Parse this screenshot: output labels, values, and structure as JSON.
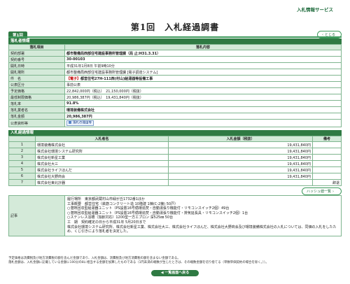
{
  "header": {
    "service_title": "入札情報サービス",
    "page_title": "第1回　入札経過調書"
  },
  "tab_label": "第1回",
  "close_label": "とじる",
  "result_section": {
    "title": "落札者情報",
    "col_item": "落札項目",
    "col_content": "落札内容",
    "rows": [
      {
        "label": "契約部署",
        "value": "都市整備局西部住宅建設事務所管理課（局 止:H31.3.31）",
        "bold": true
      },
      {
        "label": "契約番号",
        "value": "30-00103",
        "bold": true
      },
      {
        "label": "開札日時",
        "value": "平成31年1月8日 午前9時10分"
      },
      {
        "label": "開札場所",
        "value": "都市整備局西部住宅建設事務所管理課 [電子調達システム]"
      },
      {
        "label": "件　名",
        "prefix": "【電子】",
        "value": "都営住宅27H-111西(村山)給湯器等設備工事"
      },
      {
        "label": "公表区分",
        "value": "事前公表"
      },
      {
        "label": "予定価格",
        "value": "22,842,000円（税込）　21,150,000円（税抜）"
      },
      {
        "label": "最低制限価格",
        "value": "20,986,387円（税込）　19,431,840円（税抜）"
      },
      {
        "label": "落札率",
        "value": "91.8%",
        "bold": true
      },
      {
        "label": "落札業者名",
        "value": "環境装備株式会社",
        "bold": true
      },
      {
        "label": "落札金額",
        "value": "20,986,387円",
        "bold": true
      },
      {
        "label": "公表資料等",
        "button": "落札の理由等"
      }
    ]
  },
  "bids_section": {
    "title": "入札経過情報",
    "col_no": "",
    "col_name": "入札者名",
    "col_amount": "入札金額（税抜）",
    "col_note": "備考",
    "rows": [
      {
        "no": "1",
        "name": "環境装備株式会社",
        "amount": "19,431,840円",
        "note": ""
      },
      {
        "no": "2",
        "name": "株式会社環境システム研究所",
        "amount": "19,431,840円",
        "note": ""
      },
      {
        "no": "3",
        "name": "株式会社新星工業",
        "amount": "19,431,840円",
        "note": ""
      },
      {
        "no": "4",
        "name": "株式会社大三",
        "amount": "19,431,840円",
        "note": ""
      },
      {
        "no": "5",
        "name": "株式会社ライフほんだ",
        "amount": "19,431,840円",
        "note": ""
      },
      {
        "no": "6",
        "name": "株式会社大野商会",
        "amount": "19,431,840円",
        "note": ""
      },
      {
        "no": "7",
        "name": "株式会社東北計器",
        "amount": "",
        "note": "辞退"
      }
    ]
  },
  "history_button": "ハッシュ値一覧",
  "remarks": {
    "label": "記事",
    "lines": [
      "履行場所　東京都武蔵村山市緑が丘1732番1ほか",
      "工事概要　都営住宅（鉄筋コンクリート造 10階建 1棟(C-2棟) 50戸）",
      "○潜熱回収型給湯器ユニット（PS設置16号循環追焚・自動湯張り機能付・リモコンスイッチ2個）49台",
      "○潜熱回収型給湯器ユニット（PS設置16号循環追焚・自動湯張り機能付・排気延長具・リモコンスイッチ2個）1台",
      "○ステンレス浴槽（加齢対応）1200型一方エプロン 深525㎜ 50台",
      "工　期　契約確定の日から平成31年 5月20日まで",
      "株式会社環境システム研究所、株式会社新星工業、株式会社大三、株式会社ライフほんだ、株式会社大野商会及び環境装備株式会社の入札については、同価の入札をしたため、くじ引きにより落札者を決定した。"
    ]
  },
  "footnotes": [
    "予定価格は消費税及び地方消費税の額を含んだ金額であり、入札金額は、消費税及び地方消費税の額を含まない金額である。",
    "落札金額は、入札金額に記載している金額に100分の8に相当する金額を加算したものである（1円未満の端数が生じたときは、その端数金額を切り捨てる（単数単価契約の場合を除く。））。"
  ],
  "back_button": "一覧画面へ戻る"
}
